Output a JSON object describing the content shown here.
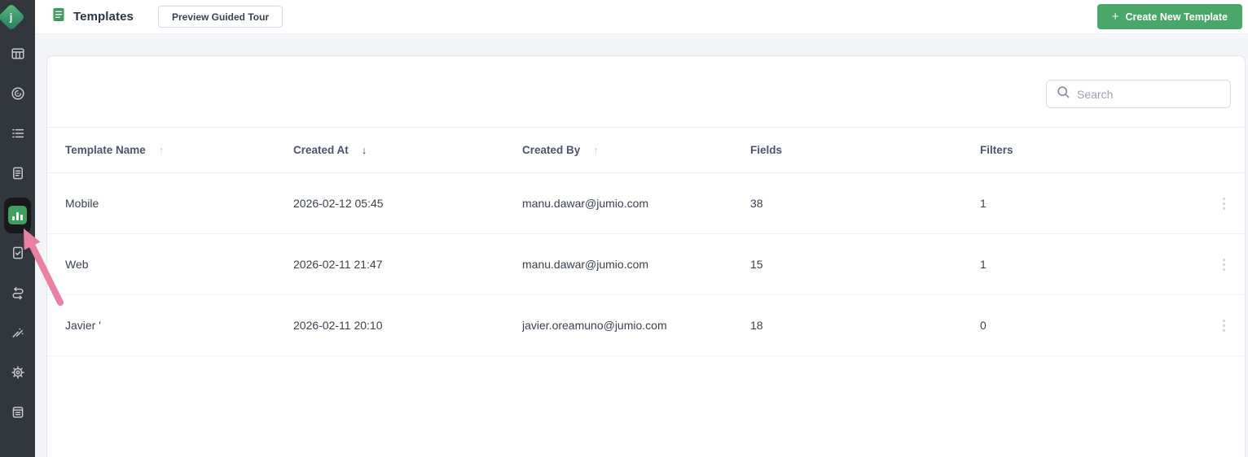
{
  "app": {
    "logo_letter": "j",
    "brand_green": "#49a76a",
    "sidebar_bg": "#32363d",
    "active_item_bg": "#17191d",
    "annotation_arrow_color": "#e9809f"
  },
  "sidebar": {
    "items": [
      {
        "id": "table-view",
        "icon": "table-columns-icon",
        "active": false
      },
      {
        "id": "target",
        "icon": "target-icon",
        "active": false
      },
      {
        "id": "list",
        "icon": "list-icon",
        "active": false
      },
      {
        "id": "document",
        "icon": "document-icon",
        "active": false
      },
      {
        "id": "analytics",
        "icon": "bar-chart-icon",
        "active": true
      },
      {
        "id": "report",
        "icon": "document-check-icon",
        "active": false
      },
      {
        "id": "workflow",
        "icon": "workflow-icon",
        "active": false
      },
      {
        "id": "tools",
        "icon": "tools-icon",
        "active": false
      },
      {
        "id": "settings",
        "icon": "gear-icon",
        "active": false
      },
      {
        "id": "archive",
        "icon": "clipboard-icon",
        "active": false
      }
    ]
  },
  "header": {
    "title": "Templates",
    "preview_tour_label": "Preview Guided Tour",
    "create_label": "Create New Template",
    "create_plus": "+"
  },
  "search": {
    "placeholder": "Search"
  },
  "table": {
    "columns": [
      {
        "label": "Template Name",
        "sort_glyph": "↑",
        "sort_state": "inactive"
      },
      {
        "label": "Created At",
        "sort_glyph": "↓",
        "sort_state": "active"
      },
      {
        "label": "Created By",
        "sort_glyph": "↑",
        "sort_state": "inactive"
      },
      {
        "label": "Fields",
        "sort_glyph": "",
        "sort_state": "none"
      },
      {
        "label": "Filters",
        "sort_glyph": "",
        "sort_state": "none"
      }
    ],
    "rows": [
      {
        "template_name": "Mobile",
        "created_at": "2026-02-12 05:45",
        "created_by": "manu.dawar@jumio.com",
        "fields": "38",
        "filters": "1"
      },
      {
        "template_name": "Web",
        "created_at": "2026-02-11 21:47",
        "created_by": "manu.dawar@jumio.com",
        "fields": "15",
        "filters": "1"
      },
      {
        "template_name": "Javier '",
        "created_at": "2026-02-11 20:10",
        "created_by": "javier.oreamuno@jumio.com",
        "fields": "18",
        "filters": "0"
      }
    ]
  }
}
